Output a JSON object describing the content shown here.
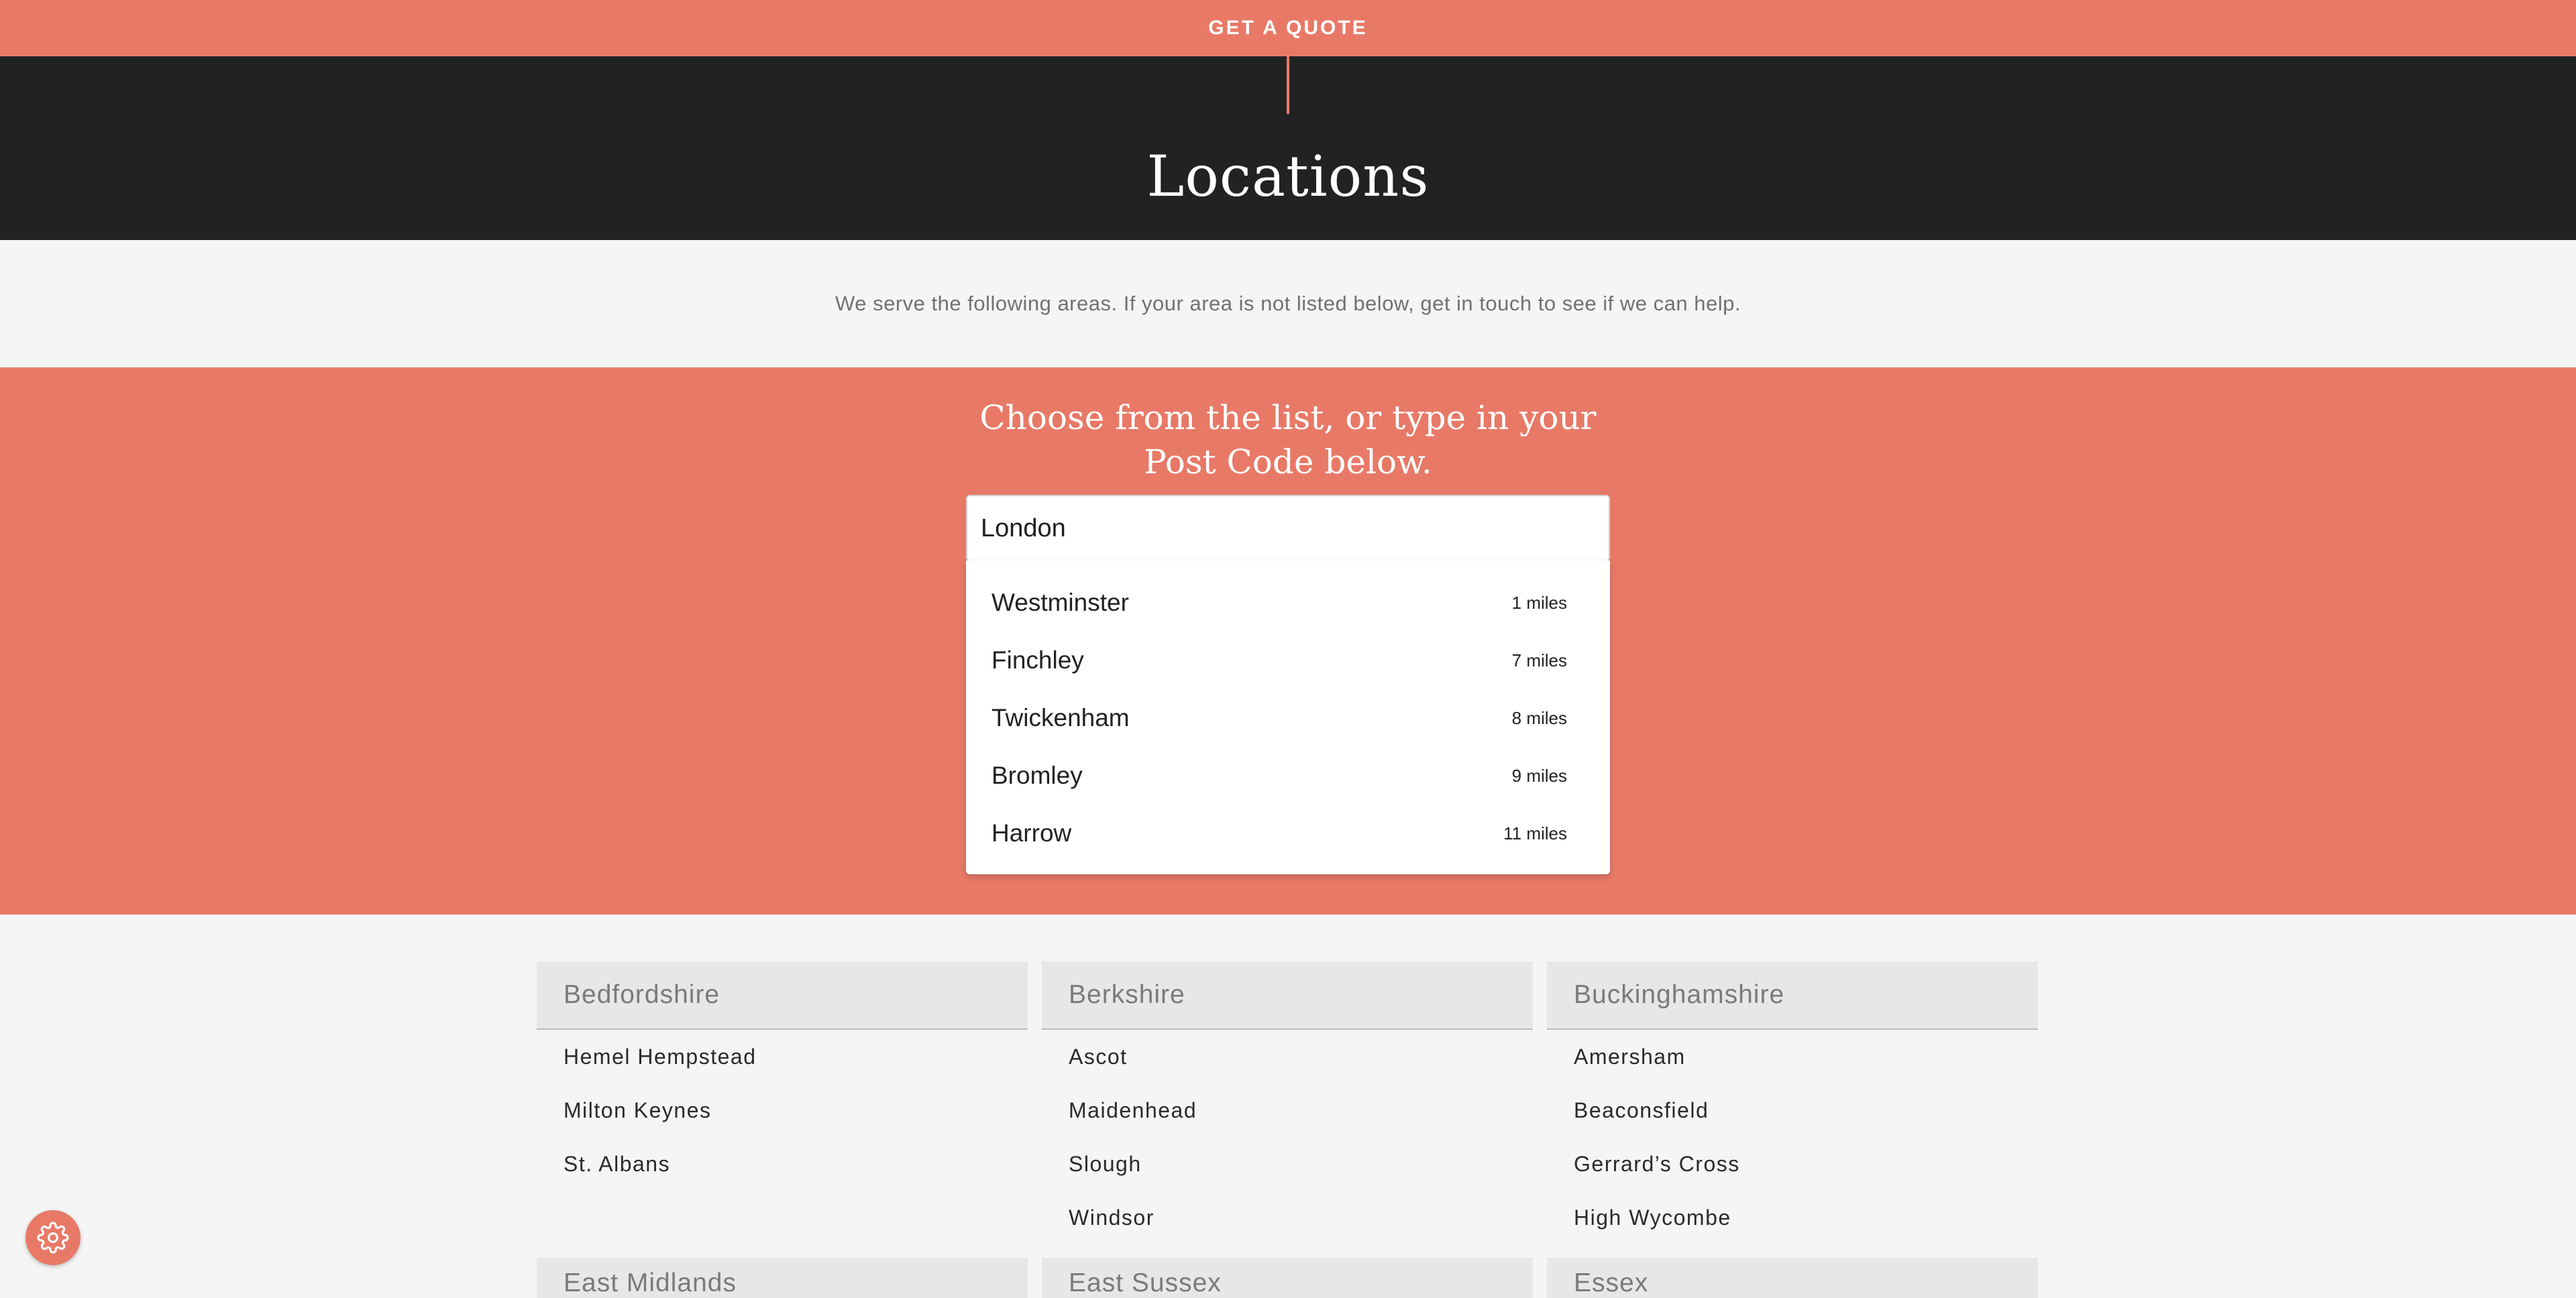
{
  "topbar": {
    "cta_label": "GET A QUOTE"
  },
  "hero": {
    "title": "Locations"
  },
  "intro": {
    "text": "We serve the following areas. If your area is not listed below, get in touch to see if we can help."
  },
  "chooser": {
    "heading": "Choose from the list, or type in your Post Code below.",
    "search": {
      "value": "London"
    },
    "results": [
      {
        "name": "Westminster",
        "distance": "1 miles"
      },
      {
        "name": "Finchley",
        "distance": "7 miles"
      },
      {
        "name": "Twickenham",
        "distance": "8 miles"
      },
      {
        "name": "Bromley",
        "distance": "9 miles"
      },
      {
        "name": "Harrow",
        "distance": "11 miles"
      }
    ]
  },
  "regions": [
    {
      "name": "Bedfordshire",
      "towns": [
        "Hemel Hempstead",
        "Milton Keynes",
        "St. Albans"
      ]
    },
    {
      "name": "Berkshire",
      "towns": [
        "Ascot",
        "Maidenhead",
        "Slough",
        "Windsor"
      ]
    },
    {
      "name": "Buckinghamshire",
      "towns": [
        "Amersham",
        "Beaconsfield",
        "Gerrard’s Cross",
        "High Wycombe"
      ]
    }
  ],
  "regions_next_row": [
    "East Midlands",
    "East Sussex",
    "Essex"
  ],
  "icons": {
    "settings": "gear-icon"
  },
  "colors": {
    "accent": "#e87967",
    "dark": "#212322",
    "background": "#f5f5f5"
  }
}
